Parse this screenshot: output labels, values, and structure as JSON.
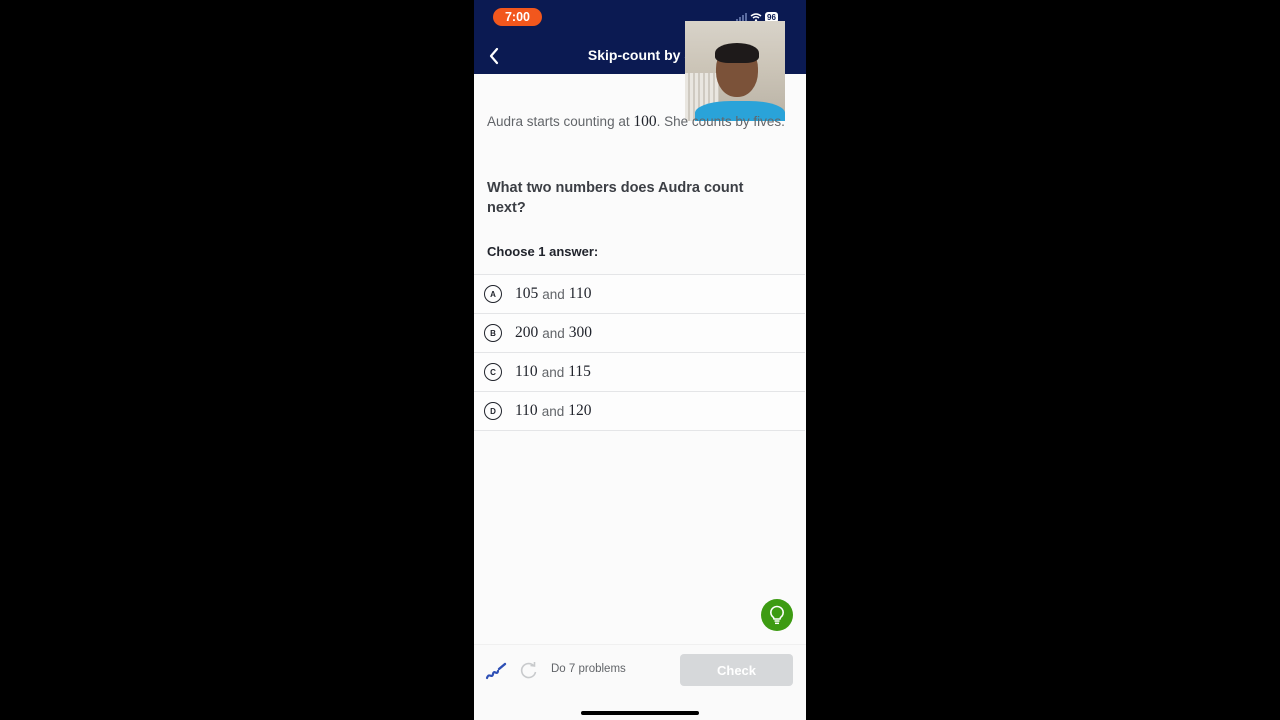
{
  "status_bar": {
    "time": "7:00",
    "battery": "96"
  },
  "header": {
    "title": "Skip-count by 5",
    "back_icon": "chevron-left-icon"
  },
  "problem": {
    "prompt_before": "Audra starts counting at ",
    "start_number": "100",
    "prompt_after": ". She counts by fives.",
    "question": "What two numbers does Audra count next?",
    "instruction": "Choose 1 answer:"
  },
  "choices": [
    {
      "letter": "A",
      "first": "105",
      "connector": "and",
      "second": "110"
    },
    {
      "letter": "B",
      "first": "200",
      "connector": "and",
      "second": "300"
    },
    {
      "letter": "C",
      "first": "110",
      "connector": "and",
      "second": "115"
    },
    {
      "letter": "D",
      "first": "110",
      "connector": "and",
      "second": "120"
    }
  ],
  "footer": {
    "progress_label": "Do 7 problems",
    "check_label": "Check",
    "scratchpad_icon": "scratchpad-icon",
    "redo_icon": "redo-icon",
    "hint_icon": "lightbulb-icon"
  },
  "colors": {
    "header_bg": "#0b1a52",
    "time_pill": "#f2571d",
    "hint_green": "#3d9b12",
    "scratchpad_blue": "#2d4fb5",
    "check_disabled": "#d6d8da"
  }
}
